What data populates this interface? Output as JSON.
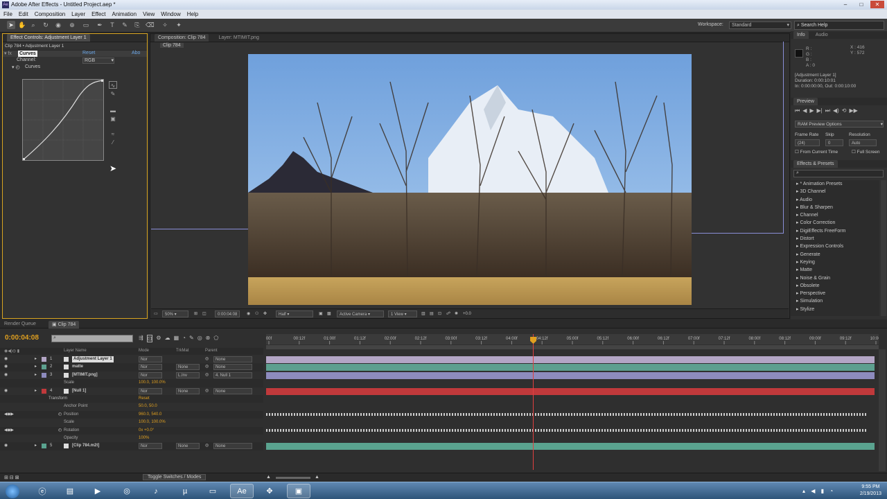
{
  "window": {
    "title": "Adobe After Effects - Untitled Project.aep *",
    "app_icon": "Ae"
  },
  "menu": [
    "File",
    "Edit",
    "Composition",
    "Layer",
    "Effect",
    "Animation",
    "View",
    "Window",
    "Help"
  ],
  "toolbar": {
    "workspace_label": "Workspace:",
    "workspace_value": "Standard",
    "search_placeholder": "Search Help"
  },
  "effect_controls": {
    "tab": "Effect Controls: Adjustment Layer 1",
    "breadcrumb": "Clip 784 • Adjustment Layer 1",
    "effect_name": "Curves",
    "reset": "Reset",
    "about": "Abo",
    "channel_label": "Channel:",
    "channel_value": "RGB",
    "curves_label": "Curves"
  },
  "composition": {
    "tab1": "Composition: Clip 784",
    "tab2": "Layer: MTIMIT.png",
    "crumb": "Clip 784",
    "footer": {
      "zoom": "50%",
      "timecode": "0:00:04:08",
      "resolution": "Half",
      "camera": "Active Camera",
      "views": "1 View",
      "exposure": "+0.0"
    }
  },
  "info": {
    "tabs": [
      "Info",
      "Audio"
    ],
    "r": "R :",
    "g": "G :",
    "b": "B :",
    "a": "A : 0",
    "x": "X : 416",
    "y": "Y : 572",
    "layer": "[Adjustment Layer 1]",
    "duration": "Duration: 0:00:10:01",
    "inout": "In: 0:00:00:00, Out: 0:00:10:00"
  },
  "preview": {
    "tab": "Preview",
    "options": "RAM Preview Options",
    "frame_rate_label": "Frame Rate",
    "skip_label": "Skip",
    "resolution_label": "Resolution",
    "frame_rate": "(24)",
    "skip": "0",
    "resolution": "Auto",
    "from_current": "From Current Time",
    "full_screen": "Full Screen"
  },
  "effects_presets": {
    "tab": "Effects & Presets",
    "items": [
      "* Animation Presets",
      "3D Channel",
      "Audio",
      "Blur & Sharpen",
      "Channel",
      "Color Correction",
      "DigiEffects FreeForm",
      "Distort",
      "Expression Controls",
      "Generate",
      "Keying",
      "Matte",
      "Noise & Grain",
      "Obsolete",
      "Perspective",
      "Simulation",
      "Stylize"
    ]
  },
  "timeline": {
    "tabs": [
      "Render Queue",
      "Clip 784"
    ],
    "timecode": "0:00:04:08",
    "headers": {
      "source": "Layer Name",
      "mode": "Mode",
      "trkmat": "TrkMat",
      "parent": "Parent"
    },
    "ruler": [
      "00f",
      "00:12f",
      "01:00f",
      "01:12f",
      "02:00f",
      "02:12f",
      "03:00f",
      "03:12f",
      "04:00f",
      "04:12f",
      "05:00f",
      "05:12f",
      "06:00f",
      "06:12f",
      "07:00f",
      "07:12f",
      "08:00f",
      "08:12f",
      "09:00f",
      "09:12f",
      "10:00f"
    ],
    "rows": [
      {
        "num": "1",
        "name": "Adjustment Layer 1",
        "mode": "Nor",
        "trk": "",
        "parent": "None",
        "color": "#b3a5c5",
        "kind": "layer",
        "hl": true
      },
      {
        "num": "2",
        "name": "matte",
        "mode": "Nor",
        "trk": "None",
        "parent": "None",
        "color": "#5d9f8f",
        "kind": "layer"
      },
      {
        "num": "3",
        "name": "[MTIMIT.png]",
        "mode": "Nor",
        "trk": "L.Inv",
        "parent": "4. Null 1",
        "color": "#8d8bbe",
        "kind": "layer"
      },
      {
        "num": "",
        "name": "Scale",
        "val": "100.0, 100.0%",
        "kind": "prop"
      },
      {
        "num": "4",
        "name": "[Null 1]",
        "mode": "Nor",
        "trk": "None",
        "parent": "None",
        "color": "#c0393b",
        "kind": "layer"
      },
      {
        "num": "",
        "name": "Transform",
        "val": "Reset",
        "kind": "group"
      },
      {
        "num": "",
        "name": "Anchor Point",
        "val": "50.0, 50.0",
        "kind": "prop"
      },
      {
        "num": "",
        "name": "Position",
        "val": "960.0, 540.0",
        "kind": "prop",
        "keys": true
      },
      {
        "num": "",
        "name": "Scale",
        "val": "100.0, 100.0%",
        "kind": "prop"
      },
      {
        "num": "",
        "name": "Rotation",
        "val": "0x +0.0°",
        "kind": "prop",
        "keys": true
      },
      {
        "num": "",
        "name": "Opacity",
        "val": "100%",
        "kind": "prop"
      },
      {
        "num": "5",
        "name": "[Clip 784.m2t]",
        "mode": "Nor",
        "trk": "None",
        "parent": "None",
        "color": "#5aa38f",
        "kind": "layer"
      }
    ],
    "footer": "Toggle Switches / Modes",
    "cti_position": 0.435
  },
  "taskbar": {
    "time": "9:55 PM",
    "date": "2/19/2013"
  }
}
